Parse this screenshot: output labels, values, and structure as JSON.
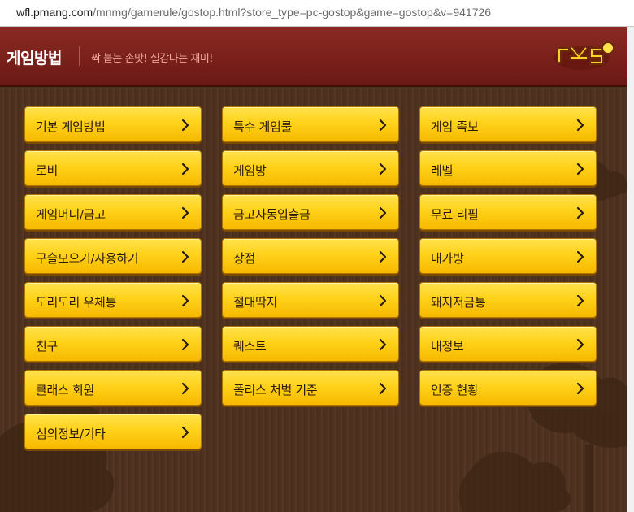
{
  "browser": {
    "url_host": "wfl.pmang.com",
    "url_path": "/mnmg/gamerule/gostop.html?store_type=pc-gostop&game=gostop&v=941726"
  },
  "header": {
    "title": "게임방법",
    "tagline": "짝 붙는 손맛! 실감나는 재미!",
    "logo": "gostop-logo"
  },
  "colors": {
    "header_red": "#7a201b",
    "button_yellow": "#ffd21a",
    "background_brown": "#4e3220"
  },
  "menu": {
    "items": [
      "기본 게임방법",
      "특수 게임룰",
      "게임 족보",
      "로비",
      "게임방",
      "레벨",
      "게임머니/금고",
      "금고자동입출금",
      "무료 리필",
      "구슬모으기/사용하기",
      "상점",
      "내가방",
      "도리도리 우체통",
      "절대딱지",
      "돼지저금통",
      "친구",
      "퀘스트",
      "내정보",
      "클래스 회원",
      "폴리스 처벌 기준",
      "인증 현황",
      "심의정보/기타"
    ],
    "arrow_icon": "chevron-right-icon"
  }
}
